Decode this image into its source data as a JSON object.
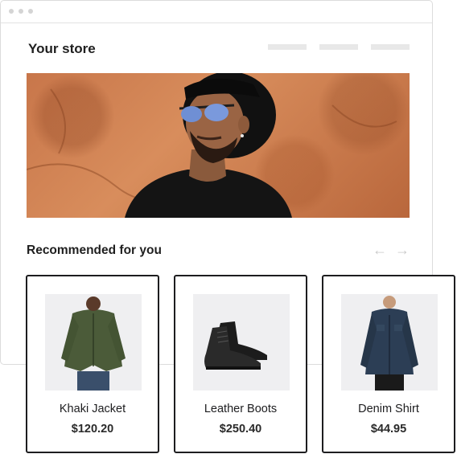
{
  "store": {
    "title": "Your store"
  },
  "recommended": {
    "title": "Recommended for you",
    "prev_icon": "arrow-left-icon",
    "next_icon": "arrow-right-icon"
  },
  "products": [
    {
      "name": "Khaki Jacket",
      "price": "$120.20",
      "image": "khaki-jacket-image"
    },
    {
      "name": "Leather Boots",
      "price": "$250.40",
      "image": "leather-boots-image"
    },
    {
      "name": "Denim Shirt",
      "price": "$44.95",
      "image": "denim-shirt-image"
    }
  ],
  "colors": {
    "hero_wall": "#c8764a",
    "card_border": "#1d1d1f",
    "thumb_bg": "#efeff1"
  }
}
